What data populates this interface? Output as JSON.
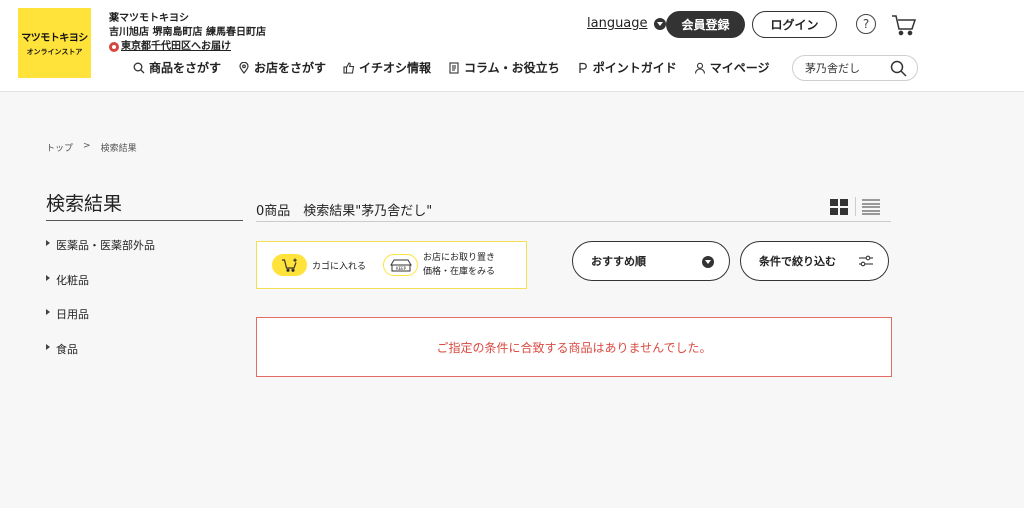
{
  "header": {
    "logo_line1": "マツモトキヨシ",
    "logo_line2": "オンラインストア",
    "brand": "薬マツモトキヨシ",
    "stores": "吉川旭店 堺南島町店 練馬春日町店",
    "delivery": "東京都千代田区へお届け",
    "language": "language",
    "register": "会員登録",
    "login": "ログイン",
    "help": "?",
    "search_value": "茅乃舎だし"
  },
  "nav": {
    "items": [
      {
        "label": "商品をさがす",
        "icon": "search-icon"
      },
      {
        "label": "お店をさがす",
        "icon": "location-pin-icon"
      },
      {
        "label": "イチオシ情報",
        "icon": "thumbs-up-icon"
      },
      {
        "label": "コラム・お役立ち",
        "icon": "document-icon"
      },
      {
        "label": "ポイントガイド",
        "icon": "point-icon"
      },
      {
        "label": "マイページ",
        "icon": "user-icon"
      }
    ]
  },
  "breadcrumb": {
    "home": "トップ",
    "sep": ">",
    "current": "検索結果"
  },
  "sidebar": {
    "title": "検索結果",
    "categories": [
      "医薬品・医薬部外品",
      "化粧品",
      "日用品",
      "食品"
    ]
  },
  "results": {
    "title": "0商品　検索結果\"茅乃舎だし\"",
    "legend_cart": "カゴに入れる",
    "legend_keep_line1": "お店にお取り置き",
    "legend_keep_line2": "価格・在庫をみる",
    "keep_badge": "KEEP",
    "sort_label": "おすすめ順",
    "filter_label": "条件で絞り込む",
    "empty_message": "ご指定の条件に合致する商品はありませんでした。"
  },
  "colors": {
    "brand_yellow": "#ffe33a",
    "dark": "#333333",
    "error_red": "#d94b42"
  }
}
